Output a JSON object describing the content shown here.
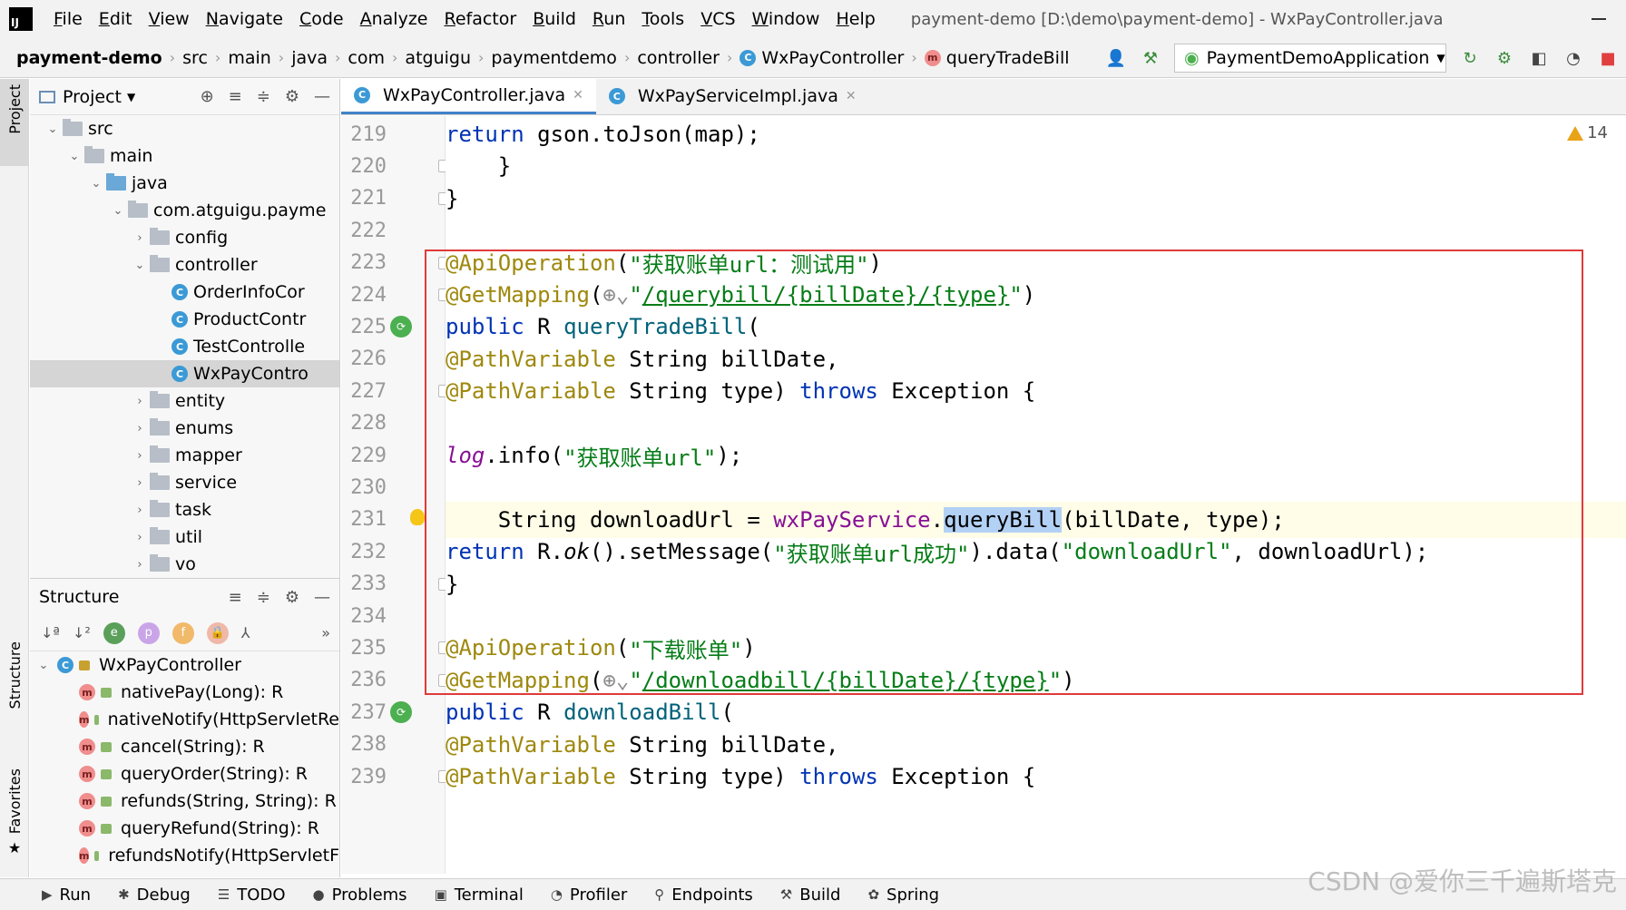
{
  "menubar": {
    "logo": "IJ",
    "items": [
      "File",
      "Edit",
      "View",
      "Navigate",
      "Code",
      "Analyze",
      "Refactor",
      "Build",
      "Run",
      "Tools",
      "VCS",
      "Window",
      "Help"
    ],
    "window_title": "payment-demo [D:\\demo\\payment-demo] - WxPayController.java"
  },
  "navbar": {
    "project": "payment-demo",
    "crumbs": [
      "src",
      "main",
      "java",
      "com",
      "atguigu",
      "paymentdemo",
      "controller"
    ],
    "class_crumb": "WxPayController",
    "method_crumb": "queryTradeBill",
    "run_config": "PaymentDemoApplication"
  },
  "left_strip": {
    "project_tab": "Project",
    "structure_tab": "Structure",
    "favorites_tab": "Favorites"
  },
  "project_panel": {
    "title": "Project",
    "tree": [
      {
        "label": "src",
        "type": "folder",
        "arrow": "⌄",
        "indent": 1
      },
      {
        "label": "main",
        "type": "folder",
        "arrow": "⌄",
        "indent": 2
      },
      {
        "label": "java",
        "type": "folder-blue",
        "arrow": "⌄",
        "indent": 3
      },
      {
        "label": "com.atguigu.payme",
        "type": "folder",
        "arrow": "⌄",
        "indent": 4
      },
      {
        "label": "config",
        "type": "folder",
        "arrow": "›",
        "indent": 5
      },
      {
        "label": "controller",
        "type": "folder",
        "arrow": "⌄",
        "indent": 5
      },
      {
        "label": "OrderInfoCor",
        "type": "class",
        "arrow": "",
        "indent": 6
      },
      {
        "label": "ProductContr",
        "type": "class",
        "arrow": "",
        "indent": 6
      },
      {
        "label": "TestControlle",
        "type": "class",
        "arrow": "",
        "indent": 6
      },
      {
        "label": "WxPayContro",
        "type": "class",
        "arrow": "",
        "indent": 6,
        "selected": true
      },
      {
        "label": "entity",
        "type": "folder",
        "arrow": "›",
        "indent": 5
      },
      {
        "label": "enums",
        "type": "folder",
        "arrow": "›",
        "indent": 5
      },
      {
        "label": "mapper",
        "type": "folder",
        "arrow": "›",
        "indent": 5
      },
      {
        "label": "service",
        "type": "folder",
        "arrow": "›",
        "indent": 5
      },
      {
        "label": "task",
        "type": "folder",
        "arrow": "›",
        "indent": 5
      },
      {
        "label": "util",
        "type": "folder",
        "arrow": "›",
        "indent": 5
      },
      {
        "label": "vo",
        "type": "folder",
        "arrow": "›",
        "indent": 5
      }
    ]
  },
  "structure_panel": {
    "title": "Structure",
    "root": "WxPayController",
    "members": [
      "nativePay(Long): R",
      "nativeNotify(HttpServletRe",
      "cancel(String): R",
      "queryOrder(String): R",
      "refunds(String, String): R",
      "queryRefund(String): R",
      "refundsNotify(HttpServletF"
    ]
  },
  "editor": {
    "tabs": [
      {
        "label": "WxPayController.java",
        "active": true
      },
      {
        "label": "WxPayServiceImpl.java",
        "active": false
      }
    ],
    "warnings_count": "14",
    "lines": [
      {
        "num": "219",
        "html": "        <span class='kw'>return</span> gson.toJson(map);",
        "fold": false
      },
      {
        "num": "220",
        "html": "    }",
        "fold": true
      },
      {
        "num": "221",
        "html": "}",
        "fold": true
      },
      {
        "num": "222",
        "html": "",
        "fold": false
      },
      {
        "num": "223",
        "html": "<span class='ann'>@ApiOperation</span>(<span class='str'>\"获取账单url：测试用\"</span>)",
        "fold": true
      },
      {
        "num": "224",
        "html": "<span class='ann'>@GetMapping</span>(<span style='color:#888'>⊕⌄</span><span class='str'>\"<span class='ul'>/querybill/{billDate}/{type}</span>\"</span>)",
        "fold": true
      },
      {
        "num": "225",
        "html": "<span class='kw'>public</span> R <span class='fn'>queryTradeBill</span>(",
        "fold": false,
        "run": true
      },
      {
        "num": "226",
        "html": "        <span class='ann'>@PathVariable</span> String billDate,",
        "fold": false
      },
      {
        "num": "227",
        "html": "        <span class='ann'>@PathVariable</span> String type) <span class='kw'>throws</span> Exception {",
        "fold": true
      },
      {
        "num": "228",
        "html": "",
        "fold": false
      },
      {
        "num": "229",
        "html": "    <span class='fld it'>log</span>.info(<span class='str'>\"获取账单url\"</span>);",
        "fold": false
      },
      {
        "num": "230",
        "html": "",
        "fold": false
      },
      {
        "num": "231",
        "html": "    String downloadUrl = <span class='fld'>wxPayService</span>.<span class='hl'>queryBill</span>(billDate, type);",
        "fold": false,
        "bulb": true,
        "current": true
      },
      {
        "num": "232",
        "html": "    <span class='kw'>return</span> R.<span class='it'>ok</span>().setMessage(<span class='str'>\"获取账单url成功\"</span>).data(<span class='str'>\"downloadUrl\"</span>, downloadUrl);",
        "fold": false
      },
      {
        "num": "233",
        "html": "}",
        "fold": true
      },
      {
        "num": "234",
        "html": "",
        "fold": false
      },
      {
        "num": "235",
        "html": "<span class='ann'>@ApiOperation</span>(<span class='str'>\"下载账单\"</span>)",
        "fold": true
      },
      {
        "num": "236",
        "html": "<span class='ann'>@GetMapping</span>(<span style='color:#888'>⊕⌄</span><span class='str'>\"<span class='ul'>/downloadbill/{billDate}/{type}</span>\"</span>)",
        "fold": true
      },
      {
        "num": "237",
        "html": "<span class='kw'>public</span> R <span class='fn'>downloadBill</span>(",
        "fold": false,
        "run": true
      },
      {
        "num": "238",
        "html": "        <span class='ann'>@PathVariable</span> String billDate,",
        "fold": false
      },
      {
        "num": "239",
        "html": "        <span class='ann'>@PathVariable</span> String type) <span class='kw'>throws</span> Exception {",
        "fold": true
      }
    ]
  },
  "bottom_bar": {
    "tools": [
      {
        "label": "Run",
        "icon": "▶"
      },
      {
        "label": "Debug",
        "icon": "✱"
      },
      {
        "label": "TODO",
        "icon": "☰"
      },
      {
        "label": "Problems",
        "icon": "●"
      },
      {
        "label": "Terminal",
        "icon": "▣"
      },
      {
        "label": "Profiler",
        "icon": "◔"
      },
      {
        "label": "Endpoints",
        "icon": "⚲"
      },
      {
        "label": "Build",
        "icon": "⚒"
      },
      {
        "label": "Spring",
        "icon": "✿"
      }
    ]
  },
  "watermark": "CSDN @爱你三千遍斯塔克",
  "colors": {
    "accent": "#4083c9",
    "highlight_box": "#e03a3a"
  }
}
